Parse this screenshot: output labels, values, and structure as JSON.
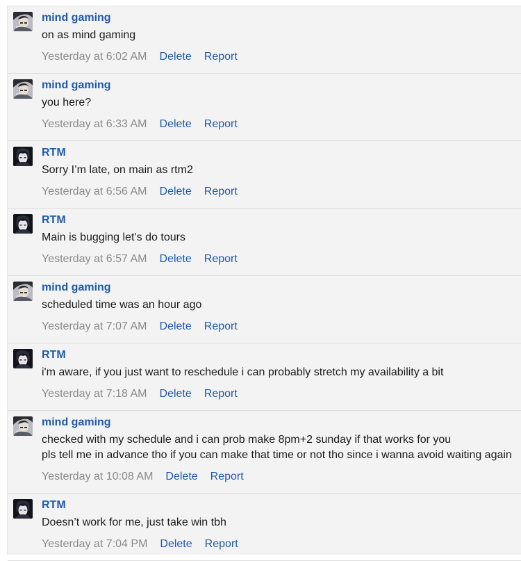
{
  "actions": {
    "delete": "Delete",
    "report": "Report"
  },
  "messages": [
    {
      "author": "mind gaming",
      "avatar_icon": "mind-gaming-avatar",
      "lines": [
        "on as mind gaming"
      ],
      "time": "Yesterday at 6:02 AM"
    },
    {
      "author": "mind gaming",
      "avatar_icon": "mind-gaming-avatar",
      "lines": [
        "you here?"
      ],
      "time": "Yesterday at 6:33 AM"
    },
    {
      "author": "RTM",
      "avatar_icon": "rtm-avatar",
      "lines": [
        "Sorry I’m late, on main as rtm2"
      ],
      "time": "Yesterday at 6:56 AM"
    },
    {
      "author": "RTM",
      "avatar_icon": "rtm-avatar",
      "lines": [
        "Main is bugging let’s do tours"
      ],
      "time": "Yesterday at 6:57 AM"
    },
    {
      "author": "mind gaming",
      "avatar_icon": "mind-gaming-avatar",
      "lines": [
        "scheduled time was an hour ago"
      ],
      "time": "Yesterday at 7:07 AM"
    },
    {
      "author": "RTM",
      "avatar_icon": "rtm-avatar",
      "lines": [
        "i'm aware, if you just want to reschedule i can probably stretch my availability a bit"
      ],
      "time": "Yesterday at 7:18 AM"
    },
    {
      "author": "mind gaming",
      "avatar_icon": "mind-gaming-avatar",
      "lines": [
        "checked with my schedule and i can prob make 8pm+2 sunday if that works for you",
        "pls tell me in advance tho if you can make that time or not tho since i wanna avoid waiting again"
      ],
      "time": "Yesterday at 10:08 AM"
    },
    {
      "author": "RTM",
      "avatar_icon": "rtm-avatar",
      "lines": [
        "Doesn’t work for me, just take win tbh"
      ],
      "time": "Yesterday at 7:04 PM"
    }
  ]
}
